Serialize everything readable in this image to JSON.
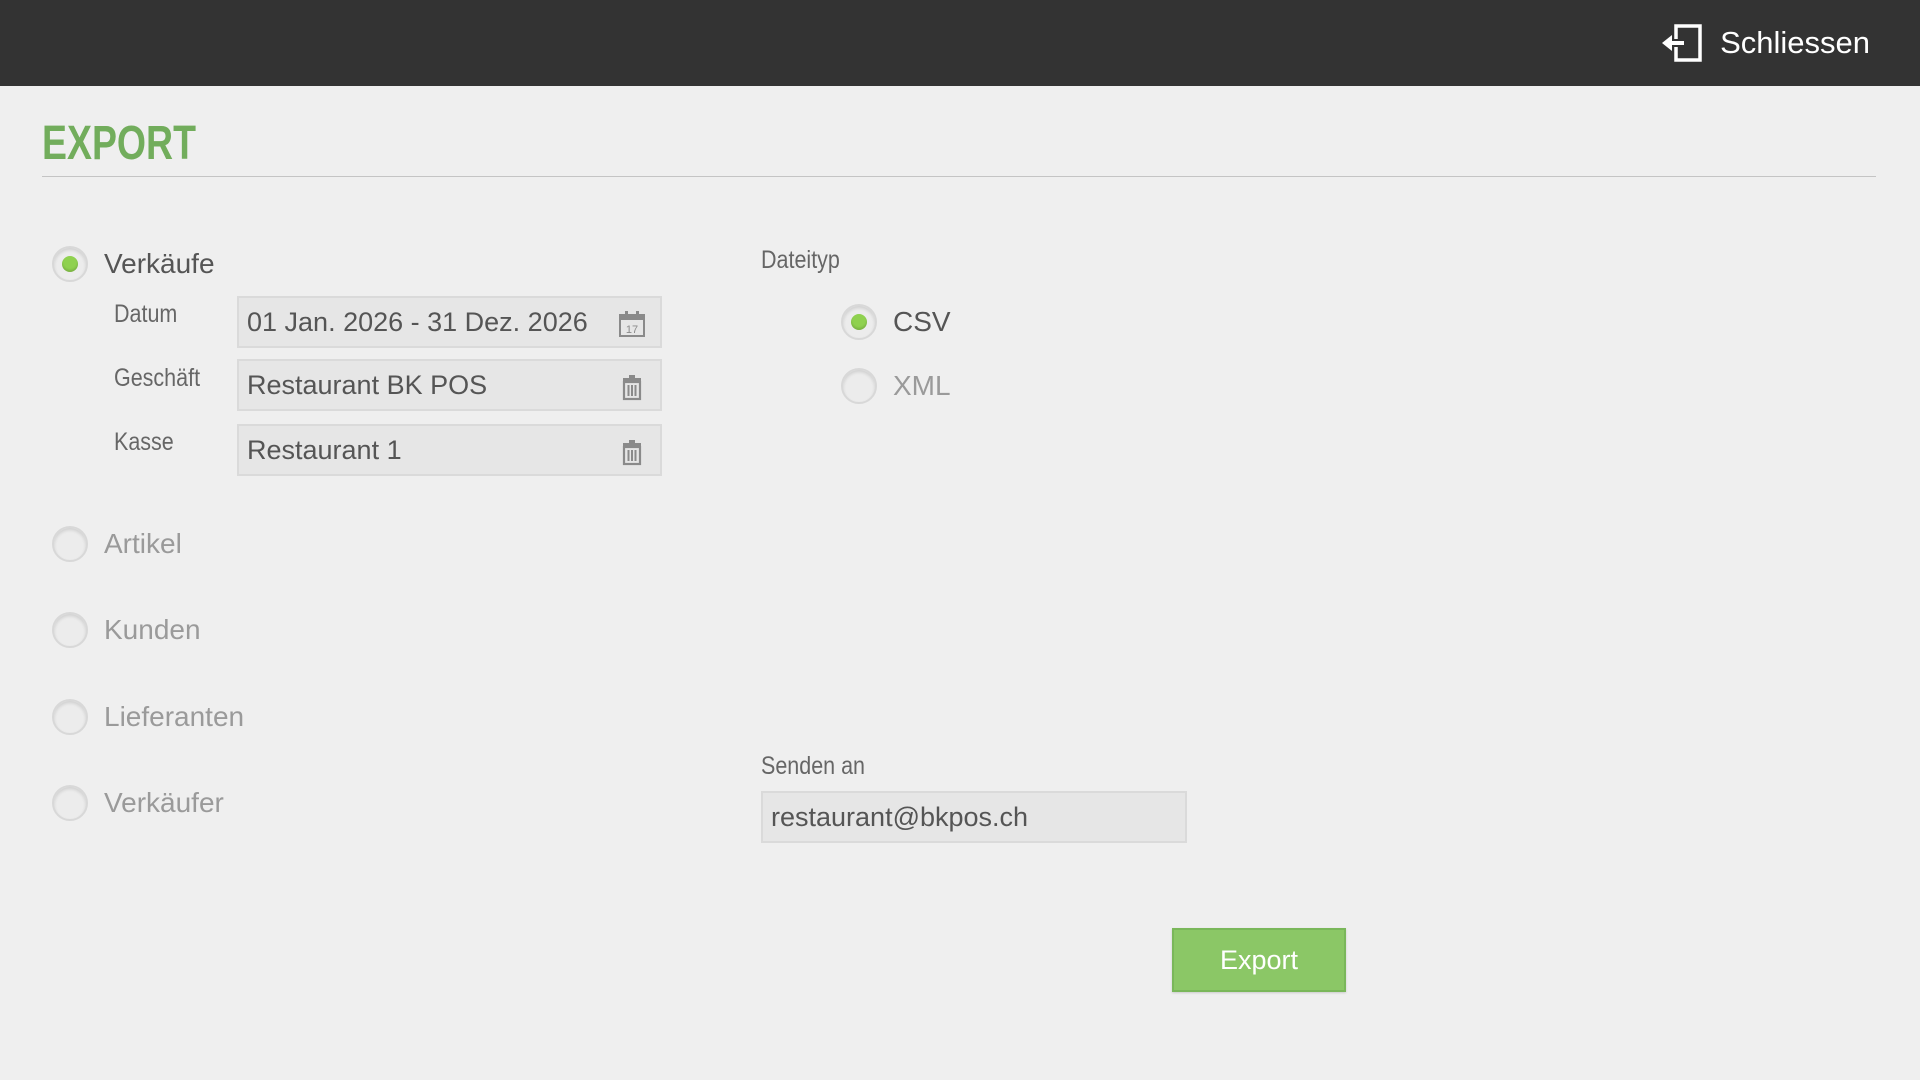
{
  "header": {
    "close_label": "Schliessen",
    "close_icon": "exit-icon"
  },
  "page": {
    "title": "EXPORT"
  },
  "export_types": [
    {
      "label": "Verkäufe",
      "selected": true
    },
    {
      "label": "Artikel",
      "selected": false
    },
    {
      "label": "Kunden",
      "selected": false
    },
    {
      "label": "Lieferanten",
      "selected": false
    },
    {
      "label": "Verkäufer",
      "selected": false
    }
  ],
  "filters": {
    "date": {
      "label": "Datum",
      "value": "01 Jan. 2026 - 31 Dez. 2026",
      "icon": "calendar-icon",
      "calendar_day": "17"
    },
    "shop": {
      "label": "Geschäft",
      "value": "Restaurant BK POS",
      "icon": "trash-icon"
    },
    "register": {
      "label": "Kasse",
      "value": "Restaurant 1",
      "icon": "trash-icon"
    }
  },
  "filetype": {
    "label": "Dateityp",
    "options": [
      {
        "label": "CSV",
        "selected": true
      },
      {
        "label": "XML",
        "selected": false
      }
    ]
  },
  "send_to": {
    "label": "Senden an",
    "value": "restaurant@bkpos.ch"
  },
  "export_button": {
    "label": "Export"
  },
  "colors": {
    "accent": "#72ad5c",
    "radio_selected": "#8fd14f",
    "button": "#8bc766",
    "topbar": "#333333"
  }
}
